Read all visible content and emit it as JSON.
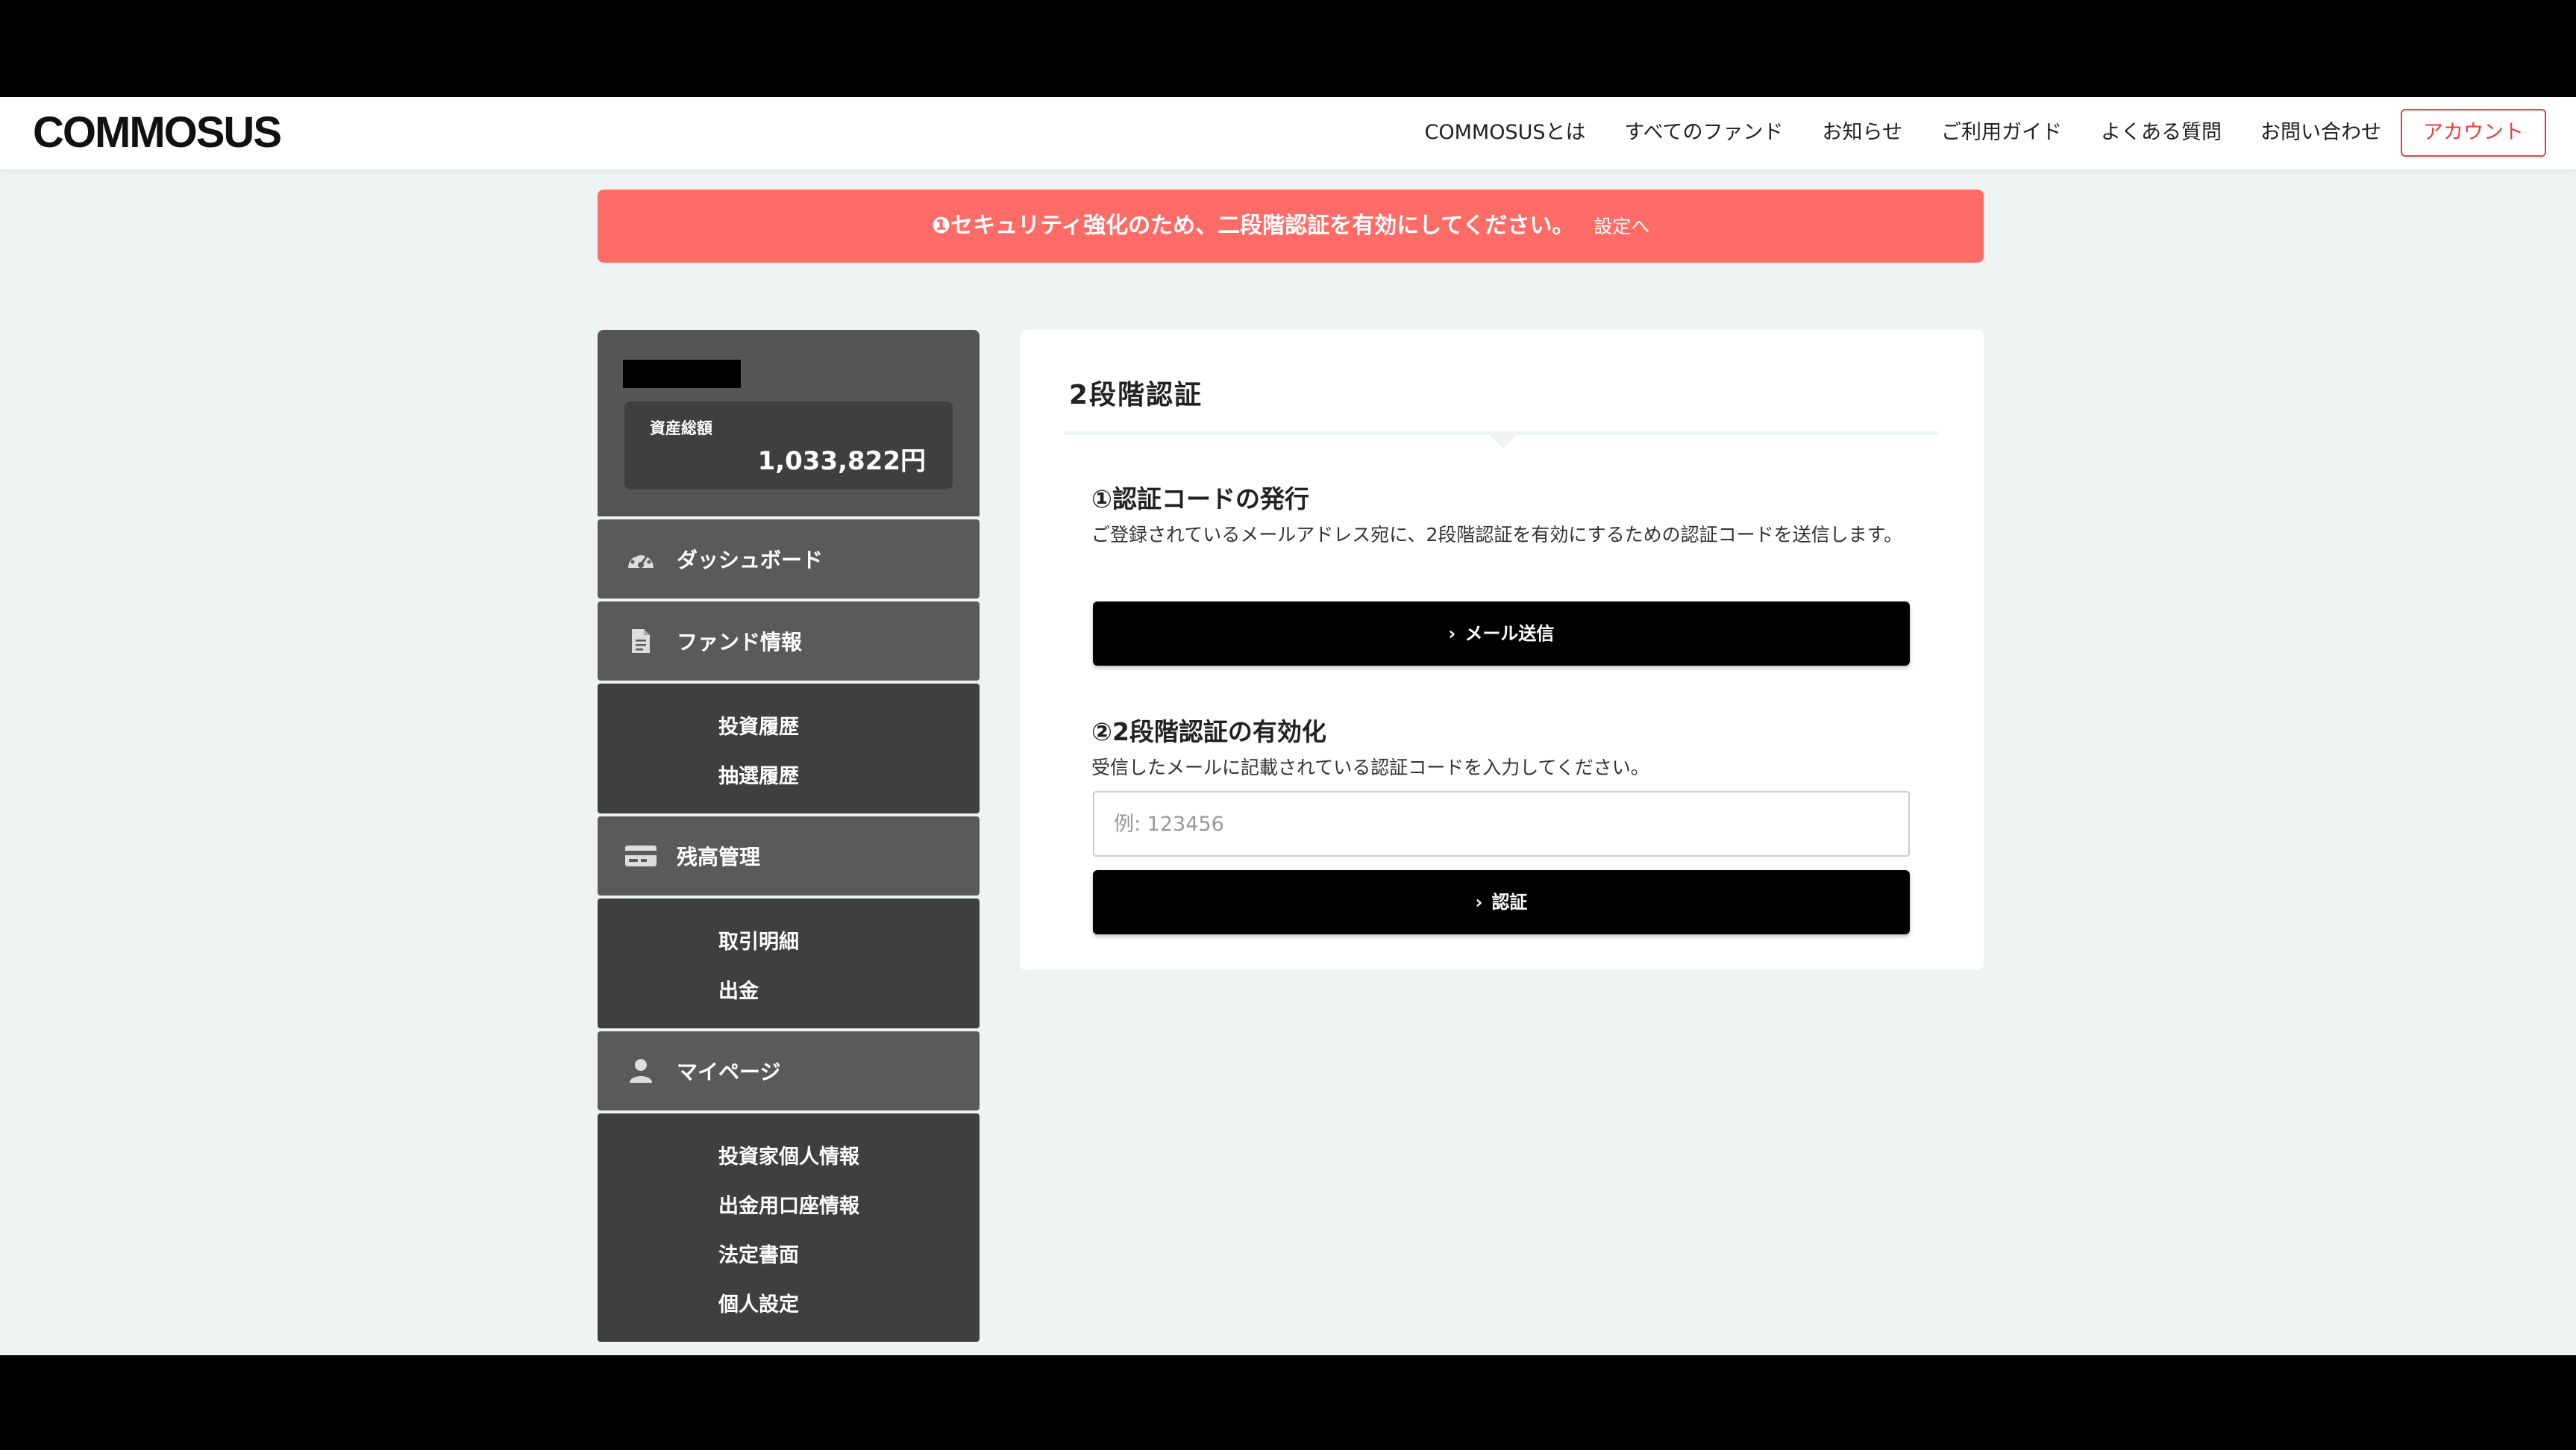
{
  "header": {
    "logo": "COMMOSUS",
    "nav": [
      "COMMOSUSとは",
      "すべてのファンド",
      "お知らせ",
      "ご利用ガイド",
      "よくある質問",
      "お問い合わせ"
    ],
    "account_label": "アカウント"
  },
  "alert": {
    "message": "❶セキュリティ強化のため、二段階認証を有効にしてください。",
    "link": "設定へ"
  },
  "sidebar": {
    "profile": {
      "asset_label": "資産総額",
      "asset_value": "1,033,822円"
    },
    "menus": [
      {
        "label": "ダッシュボード",
        "icon": "dashboard-gauge-icon",
        "subitems": []
      },
      {
        "label": "ファンド情報",
        "icon": "document-icon",
        "subitems": [
          "投資履歴",
          "抽選履歴"
        ]
      },
      {
        "label": "残高管理",
        "icon": "card-icon",
        "subitems": [
          "取引明細",
          "出金"
        ]
      },
      {
        "label": "マイページ",
        "icon": "user-icon",
        "subitems": [
          "投資家個人情報",
          "出金用口座情報",
          "法定書面",
          "個人設定"
        ]
      }
    ]
  },
  "main": {
    "title": "2段階認証",
    "step1": {
      "title": "①認証コードの発行",
      "description": "ご登録されているメールアドレス宛に、2段階認証を有効にするための認証コードを送信します。",
      "button": "メール送信"
    },
    "step2": {
      "title": "②2段階認証の有効化",
      "description": "受信したメールに記載されている認証コードを入力してください。",
      "input_value": "",
      "input_placeholder": "例: 123456",
      "button": "認証"
    }
  },
  "colors": {
    "alert": "#ff6b66",
    "accent_red": "#e8403d",
    "page_bg": "#eef3f3",
    "sidebar_head": "#5a5a5a",
    "sidebar_sub": "#3f3f3f"
  }
}
